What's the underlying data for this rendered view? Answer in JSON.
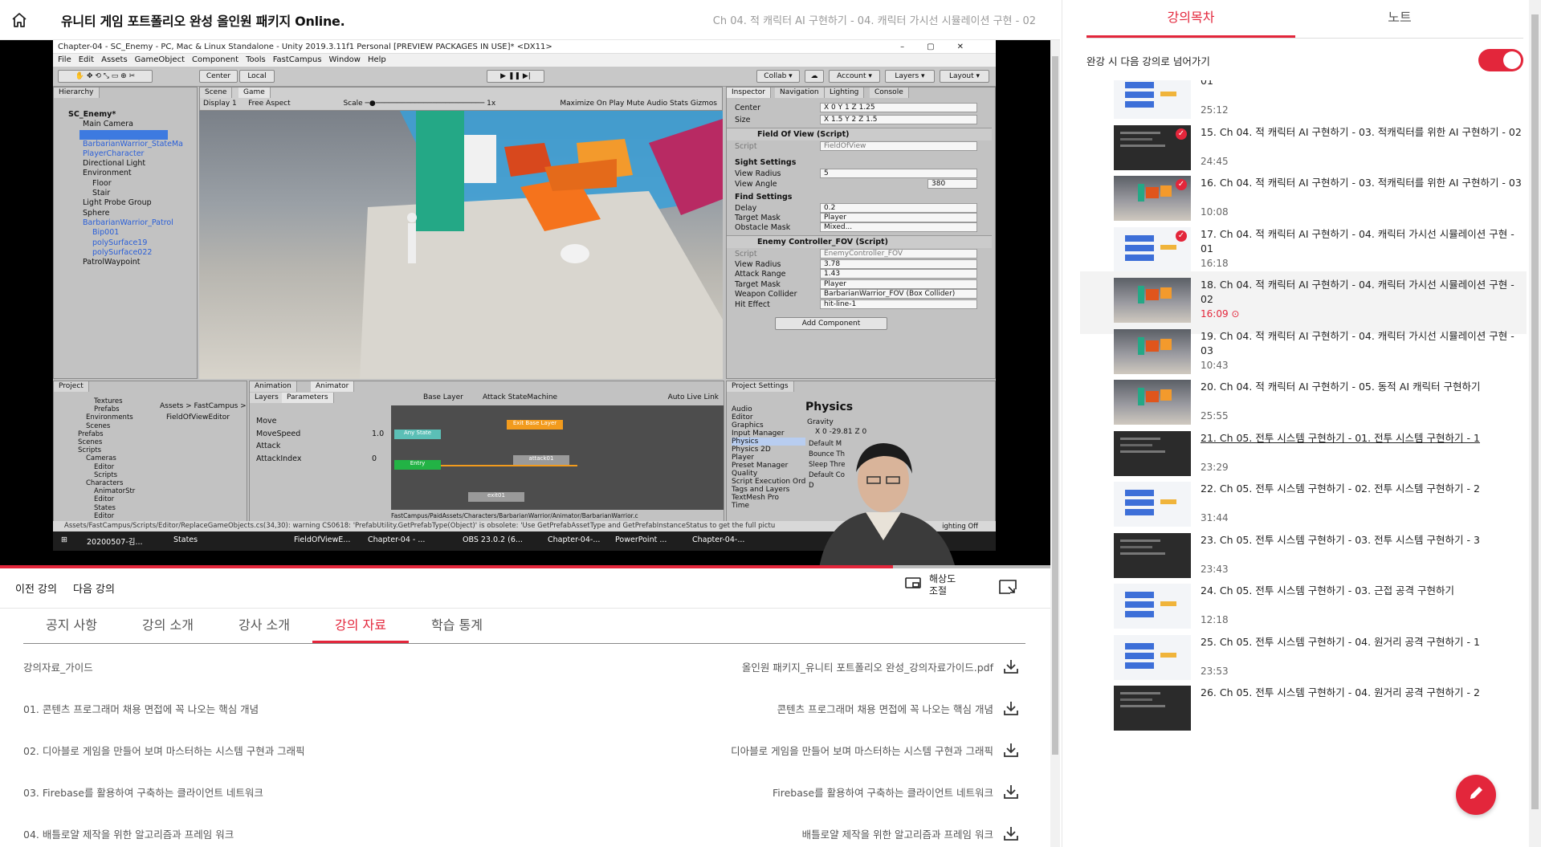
{
  "header": {
    "course_title": "유니티 게임 포트폴리오 완성 올인원 패키지 Online.",
    "lecture_title": "Ch 04. 적 캐릭터 AI 구현하기 - 04. 캐릭터 가시선 시뮬레이션 구현 - 02"
  },
  "video": {
    "progress": 0.85,
    "unity": {
      "window_title": "Chapter-04 - SC_Enemy - PC, Mac & Linux Standalone - Unity 2019.3.11f1 Personal [PREVIEW PACKAGES IN USE]* <DX11>",
      "menu": [
        "File",
        "Edit",
        "Assets",
        "GameObject",
        "Component",
        "Tools",
        "FastCampus",
        "Window",
        "Help"
      ],
      "toolbar": {
        "center": "Center",
        "local": "Local",
        "collab": "Collab ▾",
        "account": "Account ▾",
        "layers": "Layers ▾",
        "layout": "Layout ▾"
      },
      "hierarchy_tab": "Hierarchy",
      "hierarchy": [
        "SC_Enemy*",
        "Main Camera",
        "",
        "BarbarianWarrior_StateMa",
        "PlayerCharacter",
        "Directional Light",
        "Environment",
        "Floor",
        "Stair",
        "Light Probe Group",
        "Sphere",
        "BarbarianWarrior_Patrol",
        "Bip001",
        "polySurface19",
        "polySurface022",
        "PatrolWaypoint"
      ],
      "scene_tab": "Scene",
      "game_tab": "Game",
      "game_bar": {
        "display": "Display 1",
        "aspect": "Free Aspect",
        "scale": "Scale",
        "scale_value": "1x",
        "options": "Maximize On Play   Mute Audio   Stats   Gizmos"
      },
      "inspector_tabs": [
        "Inspector",
        "Navigation",
        "Lighting",
        "Console"
      ],
      "inspector": {
        "center": "Center",
        "center_vals": "X 0      Y 1      Z 1.25",
        "size": "Size",
        "size_vals": "X 1.5    Y 2      Z 1.5",
        "fov_header": "Field Of View (Script)",
        "script": "Script",
        "fov_script": "FieldOfView",
        "sight_settings": "Sight Settings",
        "view_radius": "View Radius",
        "view_radius_val": "5",
        "view_angle": "View Angle",
        "view_angle_val": "380",
        "find_settings": "Find Settings",
        "delay": "Delay",
        "delay_val": "0.2",
        "target_mask": "Target Mask",
        "target_mask_val": "Player",
        "obstacle_mask": "Obstacle Mask",
        "obstacle_mask_val": "Mixed...",
        "enemy_header": "Enemy Controller_FOV (Script)",
        "enemy_script": "EnemyController_FOV",
        "view_radius2_val": "3.78",
        "attack_range": "Attack Range",
        "attack_range_val": "1.43",
        "target_mask2_val": "Player",
        "weapon_collider": "Weapon Collider",
        "weapon_collider_val": "BarbarianWarrior_FOV (Box Collider)",
        "hit_effect": "Hit Effect",
        "hit_effect_val": "hit-line-1",
        "add_component": "Add Component"
      },
      "project_tab": "Project",
      "project_tree": [
        "Textures",
        "Prefabs",
        "Environments",
        "Scenes",
        "Prefabs",
        "Scenes",
        "Scripts",
        "Cameras",
        "Editor",
        "Scripts",
        "Characters",
        "AnimatorStr",
        "Editor",
        "States",
        "Editor"
      ],
      "project_path": "Assets > FastCampus > Scripts > C",
      "project_file": "FieldOfViewEditor",
      "animation_tab": "Animation",
      "animator_tab": "Animator",
      "anim_layers": "Layers",
      "anim_params": "Parameters",
      "anim_base": "Base Layer",
      "anim_state": "Attack StateMachine",
      "anim_autolive": "Auto Live Link",
      "anim_param_list": [
        {
          "name": "Move",
          "value": ""
        },
        {
          "name": "MoveSpeed",
          "value": "1.0"
        },
        {
          "name": "Attack",
          "value": ""
        },
        {
          "name": "AttackIndex",
          "value": "0"
        }
      ],
      "anim_nodes": [
        "Any State",
        "Entry",
        "Exit Base Layer",
        "attack01",
        "exit01"
      ],
      "anim_path": "FastCampus/PaidAssets/Characters/BarbarianWarrior/Animator/BarbarianWarrior.c",
      "project_settings_tab": "Project Settings",
      "settings_list": [
        "Audio",
        "Editor",
        "Graphics",
        "Input Manager",
        "Physics",
        "Physics 2D",
        "Player",
        "Preset Manager",
        "Quality",
        "Script Execution Ord",
        "Tags and Layers",
        "TextMesh Pro",
        "Time"
      ],
      "physics_title": "Physics",
      "gravity": "Gravity",
      "gravity_vals": "X 0      -29.81      Z 0",
      "physics_rows": [
        "Default M",
        "Bounce Th",
        "Sleep Thre",
        "Default Co",
        "D"
      ],
      "warning": "Assets/FastCampus/Scripts/Editor/ReplaceGameObjects.cs(34,30): warning CS0618: 'PrefabUtility.GetPrefabType(Object)' is obsolete: 'Use GetPrefabAssetType and GetPrefabInstanceStatus to get the full pictu",
      "lighting_off": "ighting Off",
      "taskbar": [
        "20200507-김...",
        "States",
        "FieldOfViewE...",
        "Chapter-04 - ...",
        "OBS 23.0.2 (6...",
        "Chapter-04-...",
        "PowerPoint ...",
        "Chapter-04-..."
      ]
    }
  },
  "controls": {
    "prev": "이전 강의",
    "next": "다음 강의",
    "resolution": "해상도 조절"
  },
  "tabs": [
    "공지 사항",
    "강의 소개",
    "강사 소개",
    "강의 자료",
    "학습 통계"
  ],
  "active_tab": 3,
  "materials": [
    {
      "left": "강의자료_가이드",
      "right": "올인원 패키지_유니티 포트폴리오 완성_강의자료가이드.pdf"
    },
    {
      "left": "01. 콘텐츠 프로그래머 채용 면접에 꼭 나오는 핵심 개념",
      "right": "콘텐츠 프로그래머 채용 면접에 꼭 나오는 핵심 개념"
    },
    {
      "left": "02. 디아블로 게임을 만들어 보며 마스터하는 시스템 구현과 그래픽",
      "right": "디아블로 게임을 만들어 보며 마스터하는 시스템 구현과 그래픽"
    },
    {
      "left": "03. Firebase를 활용하여 구축하는 클라이언트 네트워크",
      "right": "Firebase를 활용하여 구축하는 클라이언트 네트워크"
    },
    {
      "left": "04. 배틀로얄 제작을 위한 알고리즘과 프레임 워크",
      "right": "배틀로얄 제작을 위한 알고리즘과 프레임 워크"
    }
  ],
  "sidebar": {
    "tabs": [
      "강의목차",
      "노트"
    ],
    "autoplay_label": "완강 시 다음 강의로 넘어가기",
    "autoplay_on": true,
    "lectures": [
      {
        "title": "01",
        "duration": "25:12",
        "thumb": "light",
        "done": false,
        "current": false,
        "underline": false
      },
      {
        "title": "15. Ch 04. 적 캐릭터 AI 구현하기 - 03. 적캐릭터를 위한 AI 구현하기 - 02",
        "duration": "24:45",
        "thumb": "dark",
        "done": true,
        "current": false,
        "underline": false
      },
      {
        "title": "16. Ch 04. 적 캐릭터 AI 구현하기 - 03. 적캐릭터를 위한 AI 구현하기 - 03",
        "duration": "10:08",
        "thumb": "scene",
        "done": true,
        "current": false,
        "underline": false
      },
      {
        "title": "17. Ch 04. 적 캐릭터 AI 구현하기 - 04. 캐릭터 가시선 시뮬레이션 구현 - 01",
        "duration": "16:18",
        "thumb": "light",
        "done": true,
        "current": false,
        "underline": false
      },
      {
        "title": "18. Ch 04. 적 캐릭터 AI 구현하기 - 04. 캐릭터 가시선 시뮬레이션 구현 - 02",
        "duration": "16:09",
        "thumb": "scene",
        "done": false,
        "current": true,
        "underline": false
      },
      {
        "title": "19. Ch 04. 적 캐릭터 AI 구현하기 - 04. 캐릭터 가시선 시뮬레이션 구현 - 03",
        "duration": "10:43",
        "thumb": "scene",
        "done": false,
        "current": false,
        "underline": false
      },
      {
        "title": "20. Ch 04. 적 캐릭터 AI 구현하기 - 05. 동적 AI 캐릭터 구현하기",
        "duration": "25:55",
        "thumb": "scene",
        "done": false,
        "current": false,
        "underline": false
      },
      {
        "title": "21. Ch 05. 전투 시스템 구현하기 - 01. 전투 시스템 구현하기 - 1",
        "duration": "23:29",
        "thumb": "dark",
        "done": false,
        "current": false,
        "underline": true
      },
      {
        "title": "22. Ch 05. 전투 시스템 구현하기 - 02. 전투 시스템 구현하기 - 2",
        "duration": "31:44",
        "thumb": "light",
        "done": false,
        "current": false,
        "underline": false
      },
      {
        "title": "23. Ch 05. 전투 시스템 구현하기 - 03. 전투 시스템 구현하기 - 3",
        "duration": "23:43",
        "thumb": "dark",
        "done": false,
        "current": false,
        "underline": false
      },
      {
        "title": "24. Ch 05. 전투 시스템 구현하기 - 03. 근접 공격 구현하기",
        "duration": "12:18",
        "thumb": "light",
        "done": false,
        "current": false,
        "underline": false
      },
      {
        "title": "25. Ch 05. 전투 시스템 구현하기 - 04. 원거리 공격 구현하기 - 1",
        "duration": "23:53",
        "thumb": "light",
        "done": false,
        "current": false,
        "underline": false
      },
      {
        "title": "26. Ch 05. 전투 시스템 구현하기 - 04. 원거리 공격 구현하기 - 2",
        "duration": "",
        "thumb": "dark",
        "done": false,
        "current": false,
        "underline": false
      }
    ]
  },
  "colors": {
    "accent": "#e3263b",
    "text": "#222222",
    "muted": "#999999"
  }
}
